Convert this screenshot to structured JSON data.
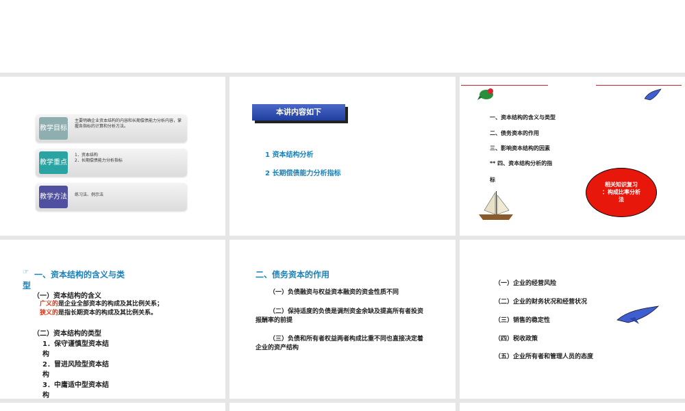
{
  "slide1": {
    "rows": [
      {
        "tag": "教学目标",
        "text": "主要明确企业资本结构的内容和长期偿债能力分析内容，掌握各指标的计算和分析方法。",
        "color": "#8eaeb0"
      },
      {
        "tag": "教学重点",
        "text": "1．资本结构\n2．长期偿债能力分析指标",
        "color": "#2aa3a3"
      },
      {
        "tag": "教学方法",
        "text": "练习法、例示法",
        "color": "#5050a0"
      }
    ]
  },
  "slide2": {
    "banner": "本讲内容如下",
    "items": [
      "1  资本结构分析",
      "2  长期偿债能力分析指标"
    ]
  },
  "slide3": {
    "items": [
      "一、资本结构的含义与类型",
      "二、债务资本的作用",
      "三、影响资本结构的因素",
      "** 四、资本结构分析的指",
      "标"
    ],
    "cloud": "相关知识复习\n：构成比率分析\n法"
  },
  "slide4": {
    "bullet": "☞",
    "title_a": "一、资本结构的含义与类",
    "title_b": "型",
    "sub1": "（一）资本结构的含义",
    "def1_red": "广义的",
    "def1_rest": "是企业全部资本的构成及其比例关系；",
    "def2_red": "狭义的",
    "def2_rest": "是指长期资本的构成及其比例关系。",
    "sub2": "（二）资本结构的类型",
    "types": [
      "1．保守谨慎型资本结",
      "构",
      "2．冒进风险型资本结",
      "构",
      "3．中庸适中型资本结",
      "构"
    ]
  },
  "slide5": {
    "title": "二、债务资本的作用",
    "paras": [
      "（一）负债融资与权益资本融资的资金性质不同",
      "（二）保持适度的负债是调剂资金余缺及提高所有者投资报酬率的前提",
      "（三）负债和所有者权益两者构成比重不同也直接决定着企业的资产结构"
    ]
  },
  "slide6": {
    "items": [
      "（一）企业的经营风险",
      "（二）企业的财务状况和经营状况",
      "（三）销售的稳定性",
      "（四）税收政策",
      "（五）企业所有者和管理人员的态度"
    ]
  }
}
